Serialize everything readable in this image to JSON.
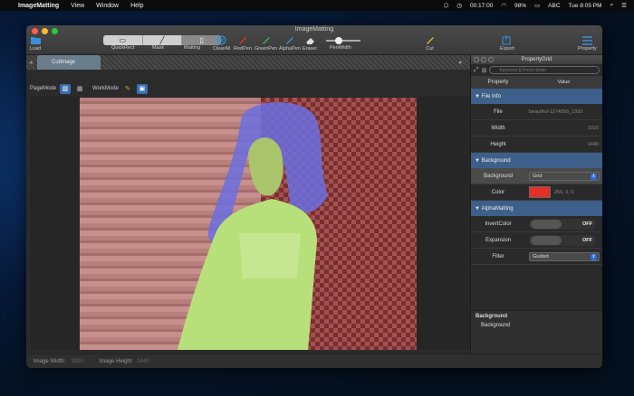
{
  "menubar": {
    "app": "ImageMatting",
    "menus": [
      "View",
      "Window",
      "Help"
    ],
    "status": {
      "time": "00:17:00",
      "battery": "98%",
      "input": "ABC",
      "clock": "Tue 8:05 PM"
    }
  },
  "window": {
    "title": "ImageMatting",
    "toolbar": {
      "load": "Load",
      "quickrect": "QuickRect",
      "mask": "Mask",
      "matting": "Matting",
      "clearall": "ClearAll",
      "redpen": "RedPen",
      "greenpen": "GreenPen",
      "alphapen": "AlphaPen",
      "eraser": "Eraser",
      "penwidth": "PenWidth",
      "cut": "Cut",
      "export": "Export",
      "property": "Property"
    },
    "tab": "CutImage",
    "modebar": {
      "page_mode": "PageMode",
      "work_mode": "WorkMode"
    },
    "status": {
      "width_label": "Image Width:",
      "width_value": "1920",
      "height_label": "Image Height",
      "height_value": "1440"
    }
  },
  "property_grid": {
    "title": "PropertyGrid",
    "search_placeholder": "Keyword & Press Enter",
    "col_property": "Property",
    "col_value": "Value",
    "file_info": {
      "section": "File Info",
      "file_label": "File",
      "file_value": "beautiful-1274056_1920",
      "width_label": "Width",
      "width_value": "1920",
      "height_label": "Height",
      "height_value": "1440"
    },
    "background": {
      "section": "Background",
      "bg_label": "Background",
      "bg_value": "Grid",
      "color_label": "Color",
      "color_value": "255, 0, 0",
      "swatch": "#e53026"
    },
    "alpha": {
      "section": "AlphaMatting",
      "invert_label": "InvertColor",
      "invert_value": "OFF",
      "expansion_label": "Expansion",
      "expansion_value": "OFF",
      "filter_label": "Filter",
      "filter_value": "Guided"
    },
    "footer": {
      "title": "Background",
      "desc": "Background"
    }
  },
  "colors": {
    "accent_blue": "#3e5f8a",
    "red_pen": "#e53026",
    "green_pen": "#3cb04a",
    "alpha_pen": "#3a8fdc"
  }
}
